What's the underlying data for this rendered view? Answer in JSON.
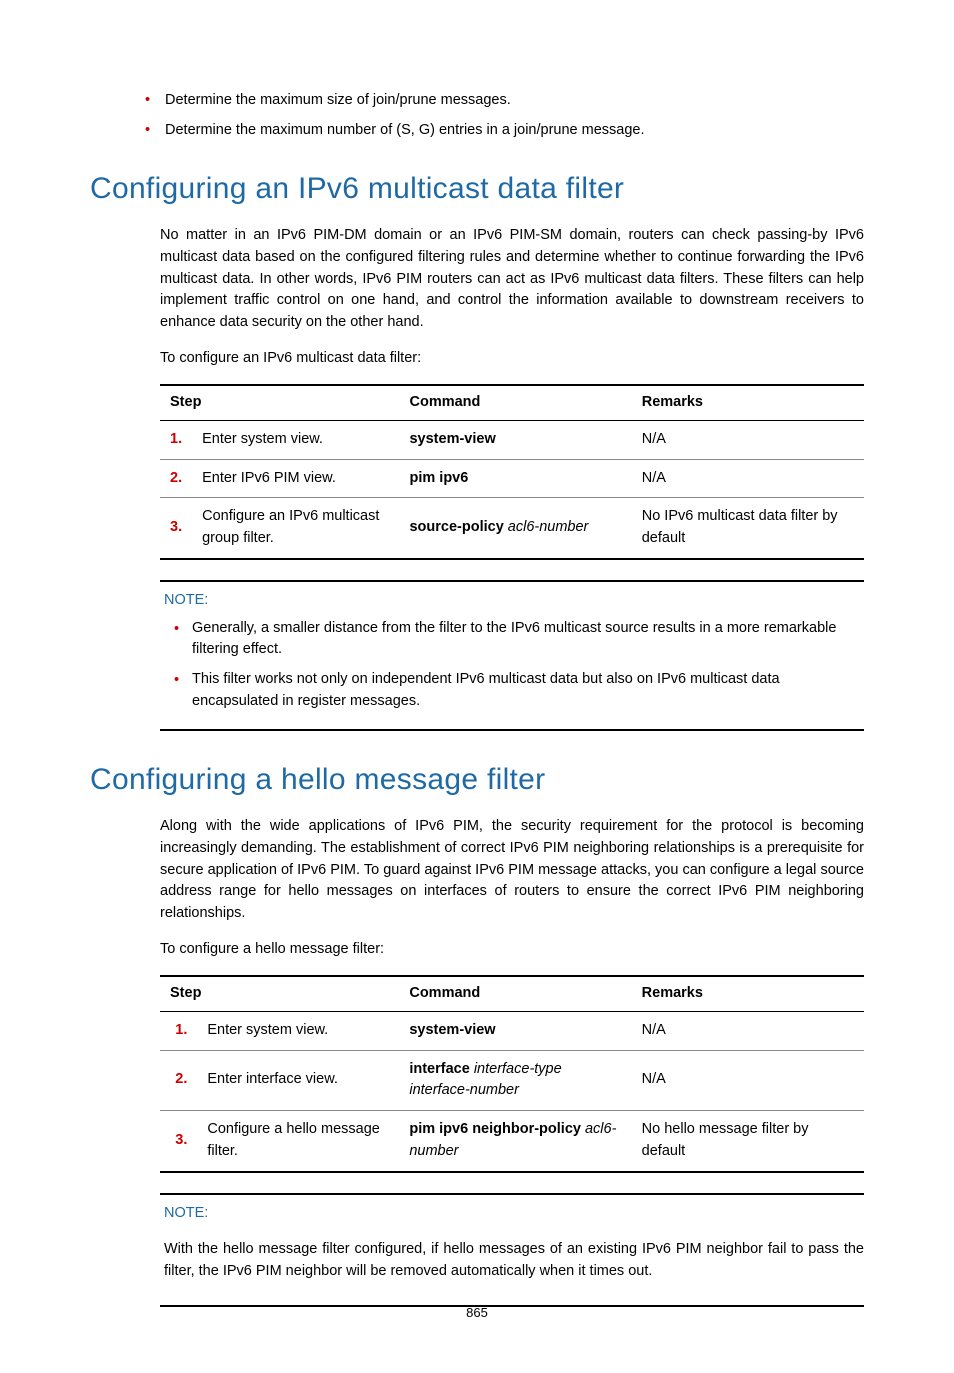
{
  "intro_bullets": [
    "Determine the maximum size of join/prune messages.",
    "Determine the maximum number of (S, G) entries in a join/prune message."
  ],
  "section1": {
    "heading": "Configuring an IPv6 multicast data filter",
    "para1": "No matter in an IPv6 PIM-DM domain or an IPv6 PIM-SM domain, routers can check passing-by IPv6 multicast data based on the configured filtering rules and determine whether to continue forwarding the IPv6 multicast data. In other words, IPv6 PIM routers can act as IPv6 multicast data filters. These filters can help implement traffic control on one hand, and control the information available to downstream receivers to enhance data security on the other hand.",
    "para2": "To configure an IPv6 multicast data filter:",
    "table": {
      "headers": {
        "step": "Step",
        "command": "Command",
        "remarks": "Remarks"
      },
      "rows": [
        {
          "num": "1.",
          "step": "Enter system view.",
          "cmd_bold": "system-view",
          "cmd_italic": "",
          "remarks": "N/A"
        },
        {
          "num": "2.",
          "step": "Enter IPv6 PIM view.",
          "cmd_bold": "pim ipv6",
          "cmd_italic": "",
          "remarks": "N/A"
        },
        {
          "num": "3.",
          "step": "Configure an IPv6 multicast group filter.",
          "cmd_bold": "source-policy",
          "cmd_italic": " acl6-number",
          "remarks": "No IPv6 multicast data filter by default"
        }
      ]
    },
    "note_label": "NOTE:",
    "note_bullets": [
      "Generally, a smaller distance from the filter to the IPv6 multicast source results in a more remarkable filtering effect.",
      "This filter works not only on independent IPv6 multicast data but also on IPv6 multicast data encapsulated in register messages."
    ]
  },
  "section2": {
    "heading": "Configuring a hello message filter",
    "para1": "Along with the wide applications of IPv6 PIM, the security requirement for the protocol is becoming increasingly demanding. The establishment of correct IPv6 PIM neighboring relationships is a prerequisite for secure application of IPv6 PIM. To guard against IPv6 PIM message attacks, you can configure a legal source address range for hello messages on interfaces of routers to ensure the correct IPv6 PIM neighboring relationships.",
    "para2": "To configure a hello message filter:",
    "table": {
      "headers": {
        "step": "Step",
        "command": "Command",
        "remarks": "Remarks"
      },
      "rows": [
        {
          "num": "1.",
          "step": "Enter system view.",
          "cmd_bold": "system-view",
          "cmd_italic": "",
          "remarks": "N/A"
        },
        {
          "num": "2.",
          "step": "Enter interface view.",
          "cmd_bold": "interface",
          "cmd_italic": " interface-type interface-number",
          "remarks": "N/A"
        },
        {
          "num": "3.",
          "step": "Configure a hello message filter.",
          "cmd_bold": "pim ipv6 neighbor-policy",
          "cmd_italic": " acl6-number",
          "remarks": "No hello message filter by default"
        }
      ]
    },
    "note_label": "NOTE:",
    "note_text": "With the hello message filter configured, if hello messages of an existing IPv6 PIM neighbor fail to pass the filter, the IPv6 PIM neighbor will be removed automatically when it times out."
  },
  "page_number": "865"
}
